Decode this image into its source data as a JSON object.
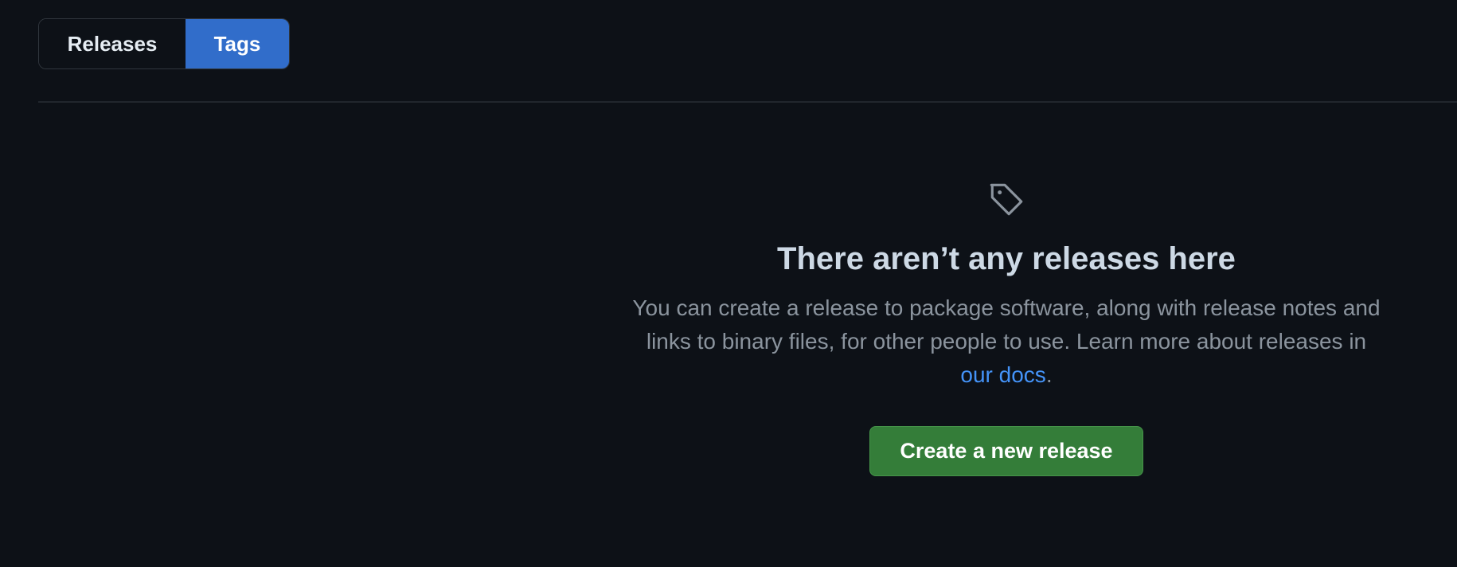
{
  "tabs": {
    "releases_label": "Releases",
    "tags_label": "Tags",
    "selected": "Tags"
  },
  "blankslate": {
    "icon": "tag-icon",
    "title": "There aren’t any releases here",
    "description_before_link": "You can create a release to package software, along with release notes and links to binary files, for other people to use. Learn more about releases in ",
    "docs_link_label": "our docs",
    "description_after_link": ".",
    "create_button_label": "Create a new release"
  },
  "colors": {
    "background": "#0d1117",
    "selected_tab": "#316dca",
    "primary_button": "#347d39",
    "link": "#4493f8"
  }
}
